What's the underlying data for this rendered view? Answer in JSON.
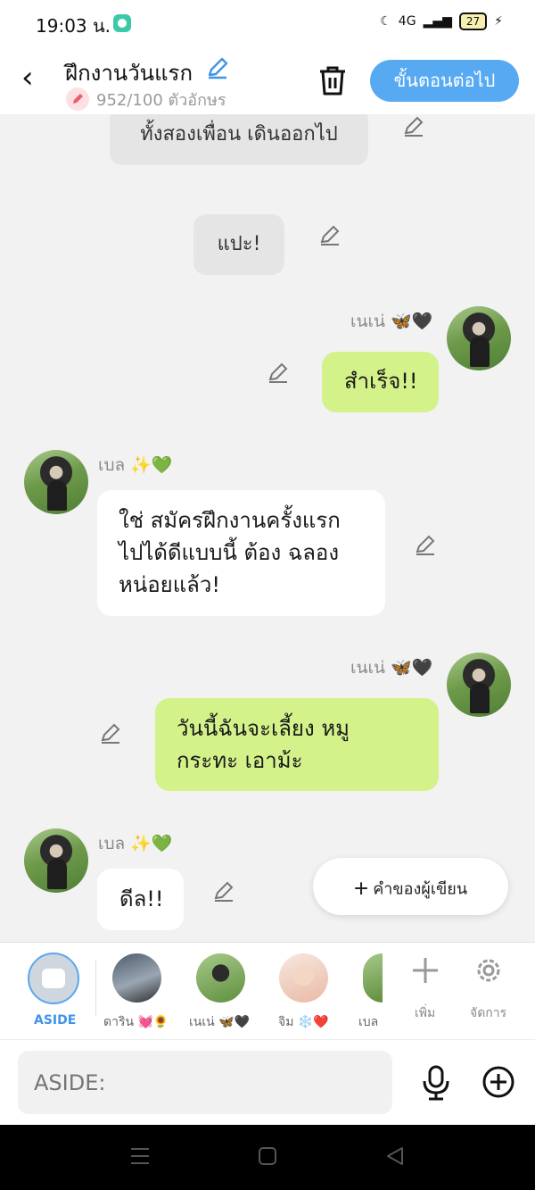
{
  "status_bar": {
    "time": "19:03 น.",
    "network": "4G",
    "battery": "27"
  },
  "header": {
    "title": "ฝึกงานวันแรก",
    "char_count": "952/100 ตัวอักษร",
    "next_button": "ขั้นตอนต่อไป"
  },
  "messages": {
    "narration_1": "ทั้งสองเพื่อน เดินออกไป",
    "narration_2": "แปะ!",
    "m1_name": "เนเน่ 🦋🖤",
    "m1_text": "สำเร็จ!!",
    "m2_name": "เบล ✨💚",
    "m2_line1": "ใช่ สมัครฝึกงานครั้งแรก",
    "m2_line2": "ไปได้ดีแบบนี้ ต้อง ฉลอง",
    "m2_line3": "หน่อยแล้ว!",
    "m3_name": "เนเน่ 🦋🖤",
    "m3_line1": "วันนี้ฉันจะเลี้ยง หมู",
    "m3_line2": "กระทะ เอาม้ะ",
    "m4_name": "เบล ✨💚",
    "m4_text": "ดีล!!"
  },
  "writer_button": "คำของผู้เขียน",
  "characters": {
    "aside": "ASIDE",
    "c1": "ดาริน 💓🌻",
    "c2": "เนเน่ 🦋🖤",
    "c3": "จิม ❄️❤️",
    "c4": "เบล",
    "add": "เพิ่ม",
    "manage": "จัดการ"
  },
  "input": {
    "placeholder": "ASIDE:"
  },
  "icons": {
    "back": "chevron-left-icon",
    "edit": "pencil-icon",
    "trash": "trash-icon",
    "plus": "plus-icon",
    "settings": "gear-icon",
    "mic": "microphone-icon",
    "add_circle": "plus-circle-icon"
  },
  "colors": {
    "accent": "#57aaf2",
    "green_bubble": "#d4f28a",
    "narration": "#e5e5e5"
  }
}
